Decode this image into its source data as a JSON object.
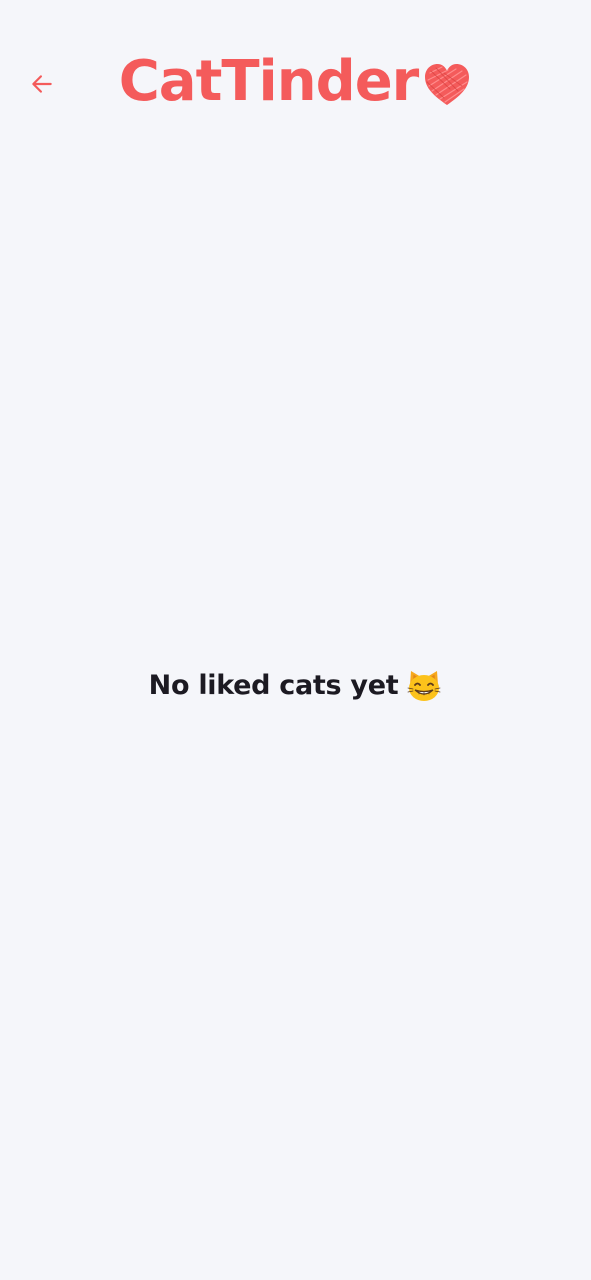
{
  "header": {
    "back_icon": "arrow-left-icon",
    "logo_text": "CatTinder",
    "logo_icon": "heart-icon",
    "accent_color": "#f45b5b"
  },
  "empty_state": {
    "message": "No liked cats yet",
    "emoji_icon": "grinning-cat-emoji-icon"
  },
  "colors": {
    "background": "#f5f6fa",
    "text": "#1c1a22"
  }
}
